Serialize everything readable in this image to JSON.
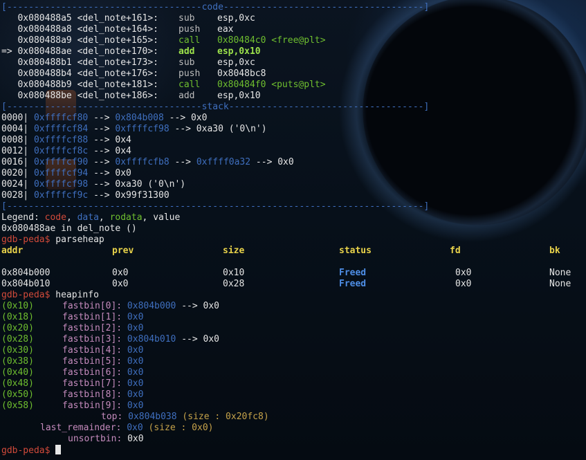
{
  "separators": {
    "code": "[------------------------------------code-------------------------------------]",
    "stack": "[------------------------------------stack------------------------------------]",
    "end": "[-----------------------------------------------------------------------------]"
  },
  "code_lines": [
    {
      "prefix": "   ",
      "addr": "0x080488a5",
      "sym": "<del_note+161>:",
      "op": "sub",
      "args": "esp,0xc",
      "extra": ""
    },
    {
      "prefix": "   ",
      "addr": "0x080488a8",
      "sym": "<del_note+164>:",
      "op": "push",
      "args": "eax",
      "extra": ""
    },
    {
      "prefix": "   ",
      "addr": "0x080488a9",
      "sym": "<del_note+165>:",
      "op": "call",
      "args": "0x80484c0",
      "extra": "<free@plt>"
    },
    {
      "prefix": "=> ",
      "addr": "0x080488ae",
      "sym": "<del_note+170>:",
      "op": "add",
      "args": "esp,0x10",
      "extra": ""
    },
    {
      "prefix": "   ",
      "addr": "0x080488b1",
      "sym": "<del_note+173>:",
      "op": "sub",
      "args": "esp,0xc",
      "extra": ""
    },
    {
      "prefix": "   ",
      "addr": "0x080488b4",
      "sym": "<del_note+176>:",
      "op": "push",
      "args": "0x8048bc8",
      "extra": ""
    },
    {
      "prefix": "   ",
      "addr": "0x080488b9",
      "sym": "<del_note+181>:",
      "op": "call",
      "args": "0x80484f0",
      "extra": "<puts@plt>"
    },
    {
      "prefix": "   ",
      "addr": "0x080488be",
      "sym": "<del_note+186>:",
      "op": "add",
      "args": "esp,0x10",
      "extra": ""
    }
  ],
  "stack_lines": [
    {
      "off": "0000|",
      "a": "0xffffcf80",
      "rest1": " --> ",
      "b": "0x804b008",
      "rest2": " --> 0x0",
      "c": "",
      "rest3": ""
    },
    {
      "off": "0004|",
      "a": "0xffffcf84",
      "rest1": " --> ",
      "b": "0xffffcf98",
      "rest2": " --> 0xa30 ('0\\n')",
      "c": "",
      "rest3": ""
    },
    {
      "off": "0008|",
      "a": "0xffffcf88",
      "rest1": " --> 0x4",
      "b": "",
      "rest2": "",
      "c": "",
      "rest3": ""
    },
    {
      "off": "0012|",
      "a": "0xffffcf8c",
      "rest1": " --> 0x4",
      "b": "",
      "rest2": "",
      "c": "",
      "rest3": ""
    },
    {
      "off": "0016|",
      "a": "0xffffcf90",
      "rest1": " --> ",
      "b": "0xffffcfb8",
      "rest2": " --> ",
      "c": "0xffff0a32",
      "rest3": " --> 0x0"
    },
    {
      "off": "0020|",
      "a": "0xffffcf94",
      "rest1": " --> 0x0",
      "b": "",
      "rest2": "",
      "c": "",
      "rest3": ""
    },
    {
      "off": "0024|",
      "a": "0xffffcf98",
      "rest1": " --> 0xa30 ('0\\n')",
      "b": "",
      "rest2": "",
      "c": "",
      "rest3": ""
    },
    {
      "off": "0028|",
      "a": "0xffffcf9c",
      "rest1": " --> 0x99f31300",
      "b": "",
      "rest2": "",
      "c": "",
      "rest3": ""
    }
  ],
  "legend": {
    "label": "Legend: ",
    "code": "code",
    "sep1": ", ",
    "data": "data",
    "sep2": ", ",
    "rodata": "rodata",
    "sep3": ", ",
    "value": "value"
  },
  "location_line": "0x080488ae in del_note ()",
  "prompt": "gdb-peda$",
  "cmd_parseheap": "parseheap",
  "cmd_heapinfo": "heapinfo",
  "heap_table": {
    "headers": [
      "addr",
      "prev",
      "size",
      "status",
      "fd",
      "bk"
    ],
    "rows": [
      {
        "addr": "0x804b000",
        "prev": "0x0",
        "size": "0x10",
        "status": "Freed",
        "fd": "0x0",
        "bk": "None"
      },
      {
        "addr": "0x804b010",
        "prev": "0x0",
        "size": "0x28",
        "status": "Freed",
        "fd": "0x0",
        "bk": "None"
      }
    ]
  },
  "fastbins": [
    {
      "size": "(0x10)",
      "name": "fastbin[0]:",
      "val": "0x804b000",
      "tail": " --> 0x0"
    },
    {
      "size": "(0x18)",
      "name": "fastbin[1]:",
      "val": "0x0",
      "tail": ""
    },
    {
      "size": "(0x20)",
      "name": "fastbin[2]:",
      "val": "0x0",
      "tail": ""
    },
    {
      "size": "(0x28)",
      "name": "fastbin[3]:",
      "val": "0x804b010",
      "tail": " --> 0x0"
    },
    {
      "size": "(0x30)",
      "name": "fastbin[4]:",
      "val": "0x0",
      "tail": ""
    },
    {
      "size": "(0x38)",
      "name": "fastbin[5]:",
      "val": "0x0",
      "tail": ""
    },
    {
      "size": "(0x40)",
      "name": "fastbin[6]:",
      "val": "0x0",
      "tail": ""
    },
    {
      "size": "(0x48)",
      "name": "fastbin[7]:",
      "val": "0x0",
      "tail": ""
    },
    {
      "size": "(0x50)",
      "name": "fastbin[8]:",
      "val": "0x0",
      "tail": ""
    },
    {
      "size": "(0x58)",
      "name": "fastbin[9]:",
      "val": "0x0",
      "tail": ""
    }
  ],
  "top": {
    "label": "top:",
    "val": "0x804b038",
    "info": "(size : 0x20fc8)"
  },
  "last_remainder": {
    "label": "last_remainder:",
    "val": "0x0",
    "info": "(size : 0x0)"
  },
  "unsortbin": {
    "label": "unsortbin:",
    "val": "0x0"
  },
  "colors": {
    "code_sep": "#3f6fbf",
    "call": "#6fbf2f",
    "current": "#9de34b",
    "prompt": "#d24a3a",
    "heap_header": "#e8d24a",
    "freed": "#4e8ee6"
  }
}
